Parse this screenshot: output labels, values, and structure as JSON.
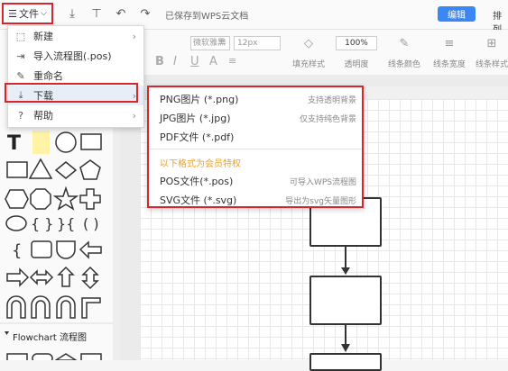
{
  "topbar": {
    "file_label": "文件",
    "saved_text": "已保存到WPS云文档",
    "edit_label": "编辑",
    "arrange_label": "排列"
  },
  "toolbar": {
    "font_value": "微软雅黑",
    "size_value": "12px",
    "percent_value": "100%",
    "tools": [
      "填充样式",
      "透明度",
      "线条颜色",
      "线条宽度",
      "线条样式"
    ]
  },
  "file_menu": {
    "items": [
      {
        "label": "新建",
        "icon": "new-file-icon",
        "has_submenu": true
      },
      {
        "label": "导入流程图(.pos)",
        "icon": "import-icon",
        "has_submenu": false
      },
      {
        "label": "重命名",
        "icon": "pencil-icon",
        "has_submenu": false
      },
      {
        "label": "下载",
        "icon": "download-icon",
        "has_submenu": true
      },
      {
        "label": "帮助",
        "icon": "help-icon",
        "has_submenu": true
      }
    ]
  },
  "download_menu": {
    "items": [
      {
        "label": "PNG图片 (*.png)",
        "hint": "支持透明背景"
      },
      {
        "label": "JPG图片 (*.jpg)",
        "hint": "仅支持纯色背景"
      },
      {
        "label": "PDF文件 (*.pdf)",
        "hint": ""
      }
    ],
    "vip_label": "以下格式为会员特权",
    "vip_items": [
      {
        "label": "POS文件(*.pos)",
        "hint": "可导入WPS流程图"
      },
      {
        "label": "SVG文件 (*.svg)",
        "hint": "导出为svg矢量图形"
      }
    ]
  },
  "shapes_panel": {
    "section_title": "Flowchart 流程图"
  },
  "colors": {
    "accent": "#3b87f5",
    "highlight": "#d9262c",
    "vip": "#f0a020"
  }
}
